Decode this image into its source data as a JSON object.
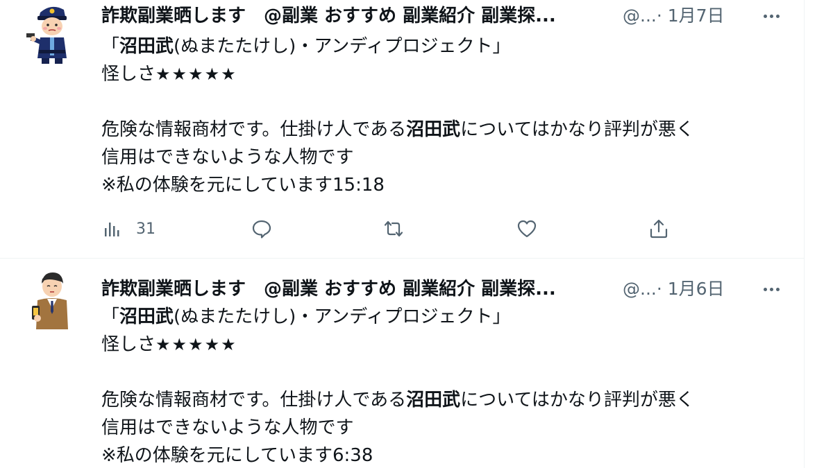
{
  "tweets": [
    {
      "display_name": "詐欺副業晒します　@副業 おすすめ 副業紹介 副業探...",
      "handle": "@...",
      "date": "· 1月7日",
      "line1": {
        "open": "「",
        "bold": "沼田武",
        "rest": "(ぬまたたけし)・アンディプロジェクト」"
      },
      "line2": {
        "label": "怪しさ",
        "stars": "★★★★★"
      },
      "line3": {
        "pre": "危険な情報商材です。仕掛け人である",
        "bold": "沼田武",
        "post": "についてはかなり評判が悪く"
      },
      "line4": "信用はできないような人物です",
      "line5": "※私の体験を元にしています15:18",
      "views": "31"
    },
    {
      "display_name": "詐欺副業晒します　@副業 おすすめ 副業紹介 副業探...",
      "handle": "@...",
      "date": "· 1月6日",
      "line1": {
        "open": "「",
        "bold": "沼田武",
        "rest": "(ぬまたたけし)・アンディプロジェクト」"
      },
      "line2": {
        "label": "怪しさ",
        "stars": "★★★★★"
      },
      "line3": {
        "pre": "危険な情報商材です。仕掛け人である",
        "bold": "沼田武",
        "post": "についてはかなり評判が悪く"
      },
      "line4": "信用はできないような人物です",
      "line5": "※私の体験を元にしています6:38"
    }
  ],
  "icons": {
    "views": "bar-chart-icon",
    "reply": "speech-bubble-icon",
    "retweet": "retweet-arrows-icon",
    "like": "heart-icon",
    "share": "upload-arrow-icon",
    "more": "ellipsis-icon"
  },
  "colors": {
    "text": "#0f1419",
    "secondary": "#536471",
    "divider": "#eff3f4"
  }
}
